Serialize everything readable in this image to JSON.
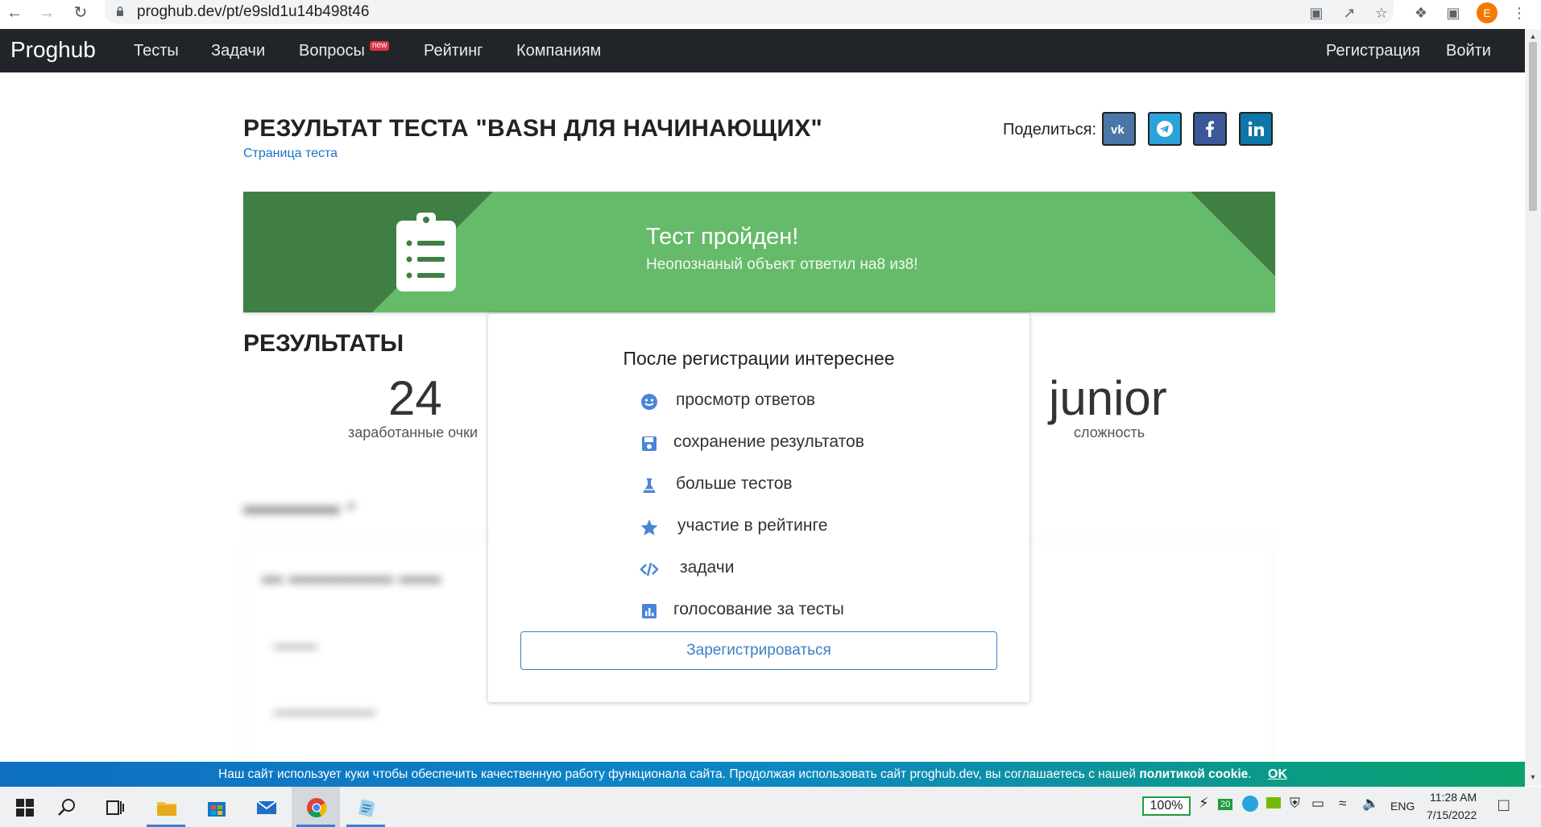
{
  "browser": {
    "url": "proghub.dev/pt/e9sld1u14b498t46",
    "profile_initial": "E"
  },
  "navbar": {
    "brand": "Proghub",
    "links": [
      "Тесты",
      "Задачи",
      "Вопросы",
      "Рейтинг",
      "Компаниям"
    ],
    "new_badge": "new",
    "register": "Регистрация",
    "login": "Войти"
  },
  "header": {
    "title": "РЕЗУЛЬТАТ ТЕСТА \"BASH ДЛЯ НАЧИНАЮЩИХ\"",
    "test_page_link": "Страница теста",
    "share_label": "Поделиться:"
  },
  "banner": {
    "title": "Тест пройден!",
    "subtitle": "Неопознаный объект ответил на8 из8!"
  },
  "results": {
    "title": "РЕЗУЛЬТАТЫ",
    "score_value": "24",
    "score_label": "заработанные очки",
    "level_value": "junior",
    "level_label": "сложность"
  },
  "modal": {
    "title": "После регистрации интереснее",
    "features": [
      "просмотр ответов",
      "сохранение результатов",
      "больше тестов",
      "участие в рейтинге",
      "задачи",
      "голосование за тесты"
    ],
    "register_button": "Зарегистрироваться"
  },
  "cookie": {
    "text": "Наш сайт использует куки чтобы обеспечить качественную работу функционала сайта. Продолжая использовать сайт proghub.dev, вы соглашаетесь с нашей ",
    "policy": "политикой cookie",
    "period": ".",
    "ok": "OK"
  },
  "taskbar": {
    "battery": "100%",
    "badge_count": "20",
    "language": "ENG",
    "time": "11:28 AM",
    "date": "7/15/2022"
  },
  "colors": {
    "navbar": "#212529",
    "banner_green": "#66bb6a",
    "banner_dark": "#3f7f44",
    "link_blue": "#1a73c9",
    "button_blue": "#3b82c4"
  }
}
